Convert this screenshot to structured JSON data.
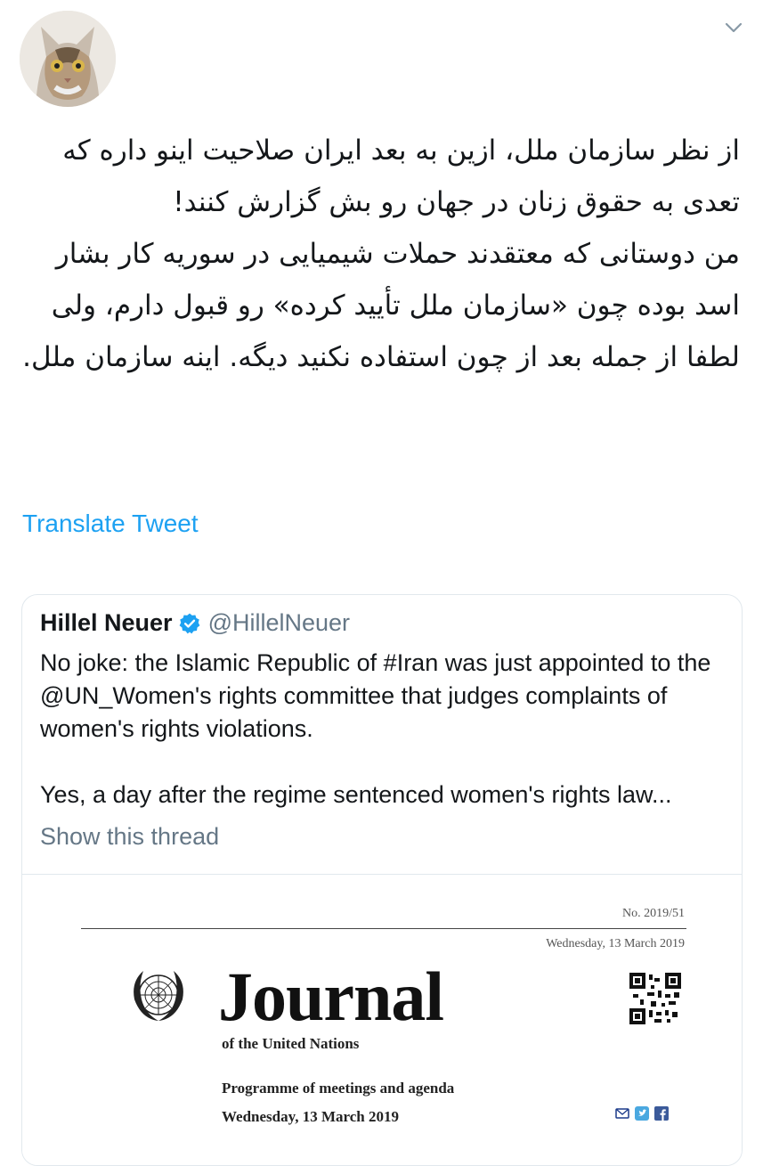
{
  "tweet": {
    "text": "از نظر سازمان ملل، ازین به بعد ایران صلاحیت اینو داره که تعدی به حقوق زنان در جهان رو بش گزارش کنند!\nمن دوستانی که معتقدند حملات شیمیایی در سوریه کار بشار اسد بوده چون «سازمان ملل تأیید کرده» رو قبول دارم، ولی لطفا از جمله بعد از چون استفاده نکنید دیگه. اینه سازمان ملل.",
    "translate_label": "Translate Tweet"
  },
  "quoted": {
    "name": "Hillel Neuer",
    "handle": "@HillelNeuer",
    "text_p1": "No joke: the Islamic Republic of #Iran was just appointed to the @UN_Women's rights committee that judges complaints of women's rights violations.",
    "text_p2": "Yes, a day after the regime sentenced women's rights law...",
    "show_thread": "Show this thread"
  },
  "document": {
    "number": "No. 2019/51",
    "date_top": "Wednesday, 13 March 2019",
    "title": "Journal",
    "subtitle": "of the United Nations",
    "programme": "Programme of meetings and agenda",
    "date_bottom": "Wednesday, 13 March 2019"
  },
  "icons": [
    "avatar-cat",
    "chevron-down-icon",
    "verified-badge-icon",
    "un-emblem",
    "qr-code",
    "mail-icon",
    "twitter-icon",
    "facebook-icon"
  ],
  "colors": {
    "link": "#1da1f2",
    "muted": "#657786",
    "border": "#e1e8ed",
    "text": "#14171a"
  }
}
